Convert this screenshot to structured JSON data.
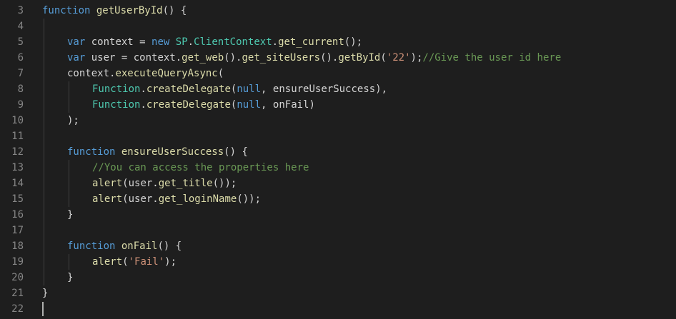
{
  "editor": {
    "lines": [
      {
        "num": "3",
        "indent": 0,
        "tokens": [
          {
            "t": "function",
            "c": "kw"
          },
          {
            "t": " getUserById",
            "c": "fn"
          },
          {
            "t": "() {",
            "c": "tx"
          }
        ]
      },
      {
        "num": "4",
        "indent": 0,
        "tokens": []
      },
      {
        "num": "5",
        "indent": 1,
        "tokens": [
          {
            "t": "var",
            "c": "kw"
          },
          {
            "t": " context ",
            "c": "tx"
          },
          {
            "t": "=",
            "c": "tx"
          },
          {
            "t": " ",
            "c": "tx"
          },
          {
            "t": "new",
            "c": "kw"
          },
          {
            "t": " ",
            "c": "tx"
          },
          {
            "t": "SP",
            "c": "ty"
          },
          {
            "t": ".",
            "c": "tx"
          },
          {
            "t": "ClientContext",
            "c": "ty"
          },
          {
            "t": ".",
            "c": "tx"
          },
          {
            "t": "get_current",
            "c": "fn"
          },
          {
            "t": "();",
            "c": "tx"
          }
        ]
      },
      {
        "num": "6",
        "indent": 1,
        "tokens": [
          {
            "t": "var",
            "c": "kw"
          },
          {
            "t": " user ",
            "c": "tx"
          },
          {
            "t": "=",
            "c": "tx"
          },
          {
            "t": " context.",
            "c": "tx"
          },
          {
            "t": "get_web",
            "c": "fn"
          },
          {
            "t": "().",
            "c": "tx"
          },
          {
            "t": "get_siteUsers",
            "c": "fn"
          },
          {
            "t": "().",
            "c": "tx"
          },
          {
            "t": "getById",
            "c": "fn"
          },
          {
            "t": "(",
            "c": "tx"
          },
          {
            "t": "'22'",
            "c": "st"
          },
          {
            "t": ");",
            "c": "tx"
          },
          {
            "t": "//Give the user id here",
            "c": "cm"
          }
        ]
      },
      {
        "num": "7",
        "indent": 1,
        "tokens": [
          {
            "t": "context.",
            "c": "tx"
          },
          {
            "t": "executeQueryAsync",
            "c": "fn"
          },
          {
            "t": "(",
            "c": "tx"
          }
        ]
      },
      {
        "num": "8",
        "indent": 2,
        "tokens": [
          {
            "t": "Function",
            "c": "ty"
          },
          {
            "t": ".",
            "c": "tx"
          },
          {
            "t": "createDelegate",
            "c": "fn"
          },
          {
            "t": "(",
            "c": "tx"
          },
          {
            "t": "null",
            "c": "kw"
          },
          {
            "t": ", ensureUserSuccess),",
            "c": "tx"
          }
        ]
      },
      {
        "num": "9",
        "indent": 2,
        "tokens": [
          {
            "t": "Function",
            "c": "ty"
          },
          {
            "t": ".",
            "c": "tx"
          },
          {
            "t": "createDelegate",
            "c": "fn"
          },
          {
            "t": "(",
            "c": "tx"
          },
          {
            "t": "null",
            "c": "kw"
          },
          {
            "t": ", onFail)",
            "c": "tx"
          }
        ]
      },
      {
        "num": "10",
        "indent": 1,
        "tokens": [
          {
            "t": ");",
            "c": "tx"
          }
        ]
      },
      {
        "num": "11",
        "indent": 0,
        "tokens": []
      },
      {
        "num": "12",
        "indent": 1,
        "tokens": [
          {
            "t": "function",
            "c": "kw"
          },
          {
            "t": " ensureUserSuccess",
            "c": "fn"
          },
          {
            "t": "() {",
            "c": "tx"
          }
        ]
      },
      {
        "num": "13",
        "indent": 2,
        "tokens": [
          {
            "t": "//You can access the properties here",
            "c": "cm"
          }
        ]
      },
      {
        "num": "14",
        "indent": 2,
        "tokens": [
          {
            "t": "alert",
            "c": "fn"
          },
          {
            "t": "(user.",
            "c": "tx"
          },
          {
            "t": "get_title",
            "c": "fn"
          },
          {
            "t": "());",
            "c": "tx"
          }
        ]
      },
      {
        "num": "15",
        "indent": 2,
        "tokens": [
          {
            "t": "alert",
            "c": "fn"
          },
          {
            "t": "(user.",
            "c": "tx"
          },
          {
            "t": "get_loginName",
            "c": "fn"
          },
          {
            "t": "());",
            "c": "tx"
          }
        ]
      },
      {
        "num": "16",
        "indent": 1,
        "tokens": [
          {
            "t": "}",
            "c": "tx"
          }
        ]
      },
      {
        "num": "17",
        "indent": 0,
        "tokens": []
      },
      {
        "num": "18",
        "indent": 1,
        "tokens": [
          {
            "t": "function",
            "c": "kw"
          },
          {
            "t": " onFail",
            "c": "fn"
          },
          {
            "t": "() {",
            "c": "tx"
          }
        ]
      },
      {
        "num": "19",
        "indent": 2,
        "tokens": [
          {
            "t": "alert",
            "c": "fn"
          },
          {
            "t": "(",
            "c": "tx"
          },
          {
            "t": "'Fail'",
            "c": "st"
          },
          {
            "t": ");",
            "c": "tx"
          }
        ]
      },
      {
        "num": "20",
        "indent": 1,
        "tokens": [
          {
            "t": "}",
            "c": "tx"
          }
        ]
      },
      {
        "num": "21",
        "indent": 0,
        "tokens": [
          {
            "t": "}",
            "c": "tx"
          }
        ]
      },
      {
        "num": "22",
        "indent": 0,
        "tokens": [],
        "cursor": true
      }
    ]
  },
  "colors": {
    "background": "#1e1e1e",
    "line_number": "#858585",
    "keyword": "#569cd6",
    "function": "#dcdcaa",
    "type": "#4ec9b0",
    "string": "#ce9178",
    "comment": "#6a9955",
    "text": "#d4d4d4"
  }
}
